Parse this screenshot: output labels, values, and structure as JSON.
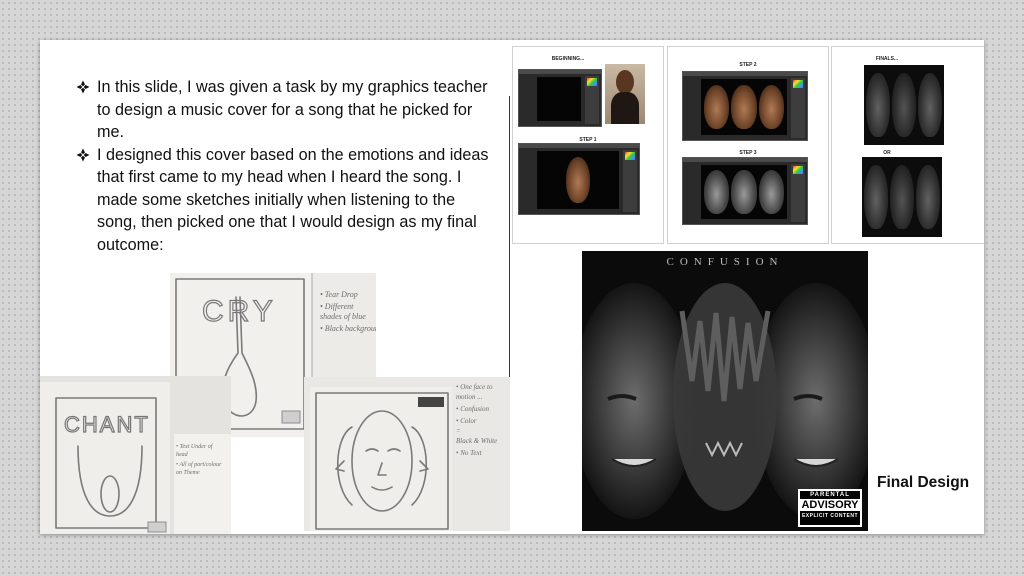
{
  "bullets": [
    "In this slide, I was given a task by my graphics teacher to design a music cover for a song that he picked for me.",
    "I designed this cover based on the emotions and ideas that first came to my head when I heard the song. I made some sketches initially when listening to the song, then picked one that I would design as my final outcome:"
  ],
  "sketches": {
    "cry": {
      "title": "CRY",
      "notes": [
        "• Tear Drop",
        "• Different",
        "  shades of blue",
        "• Black background"
      ]
    },
    "chant": {
      "title": "CHANT",
      "notes": [
        "• Text Under of",
        "  head",
        "• All of part/colour",
        "  on Theme"
      ]
    },
    "faces": {
      "notes": [
        "• One face to",
        "  motion ...",
        "• Confusion",
        "• Color",
        "  =",
        "  Black & White",
        "• No Text"
      ]
    }
  },
  "process": {
    "beginning": "BEGINNING...",
    "step1": "STEP 1",
    "step2": "STEP 2",
    "step3": "STEP 3",
    "finals": "FINALS...",
    "or": "OR"
  },
  "cover": {
    "title": "CONFUSION",
    "advisory_top": "PARENTAL",
    "advisory_mid": "ADVISORY",
    "advisory_bottom": "EXPLICIT CONTENT"
  },
  "final_label": "Final Design",
  "colors": {
    "slide_bg": "#ffffff",
    "frame_bg": "#d6d6d6",
    "text": "#111111"
  },
  "icons": {
    "bullet": "four-petal-diamond-icon"
  }
}
